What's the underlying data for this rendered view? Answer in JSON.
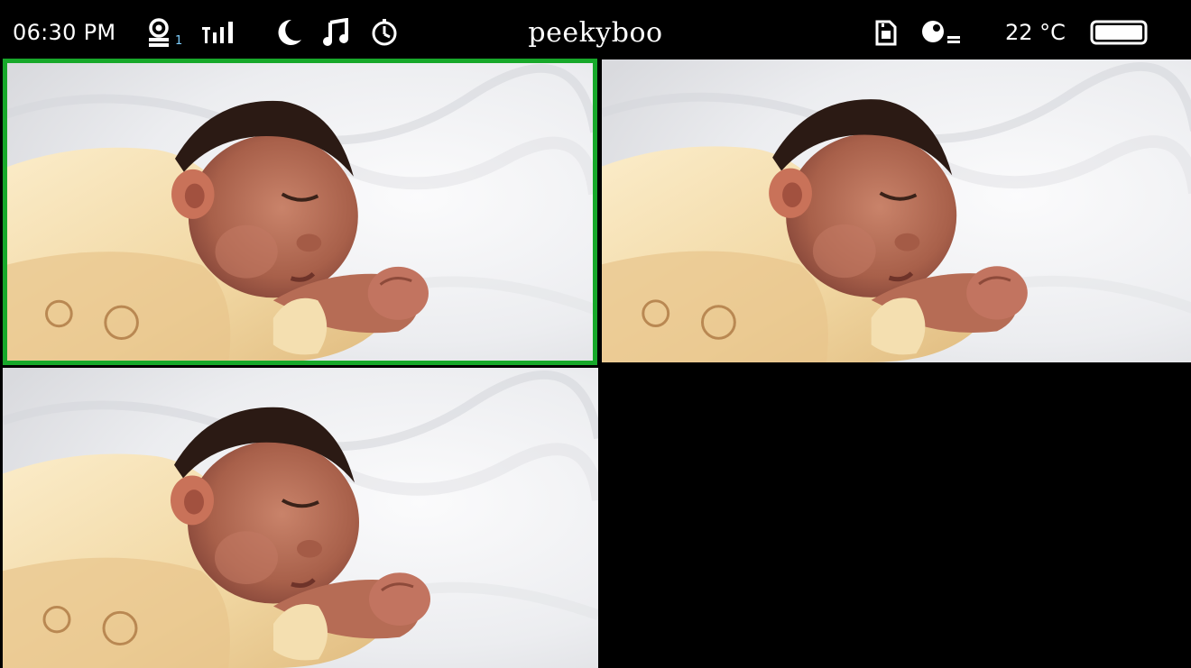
{
  "status_bar": {
    "time": "06:30 PM",
    "camera_count": "1",
    "app_title": "peekyboo",
    "temperature": "22 °C",
    "icons": [
      "baby-camera-icon",
      "signal-icon",
      "moon-icon",
      "music-note-icon",
      "timer-icon",
      "sd-card-icon",
      "feeding-icon",
      "battery-icon"
    ],
    "battery_level": 1.0
  },
  "camera_grid": {
    "selected_tile": 1,
    "tiles": [
      {
        "id": 1,
        "state": "live",
        "scene": "sleeping-baby"
      },
      {
        "id": 2,
        "state": "live",
        "scene": "sleeping-baby"
      },
      {
        "id": 3,
        "state": "live",
        "scene": "sleeping-baby"
      },
      {
        "id": 4,
        "state": "empty"
      }
    ]
  },
  "colors": {
    "background": "#000000",
    "selection": "#17a82a",
    "text": "#ffffff"
  }
}
